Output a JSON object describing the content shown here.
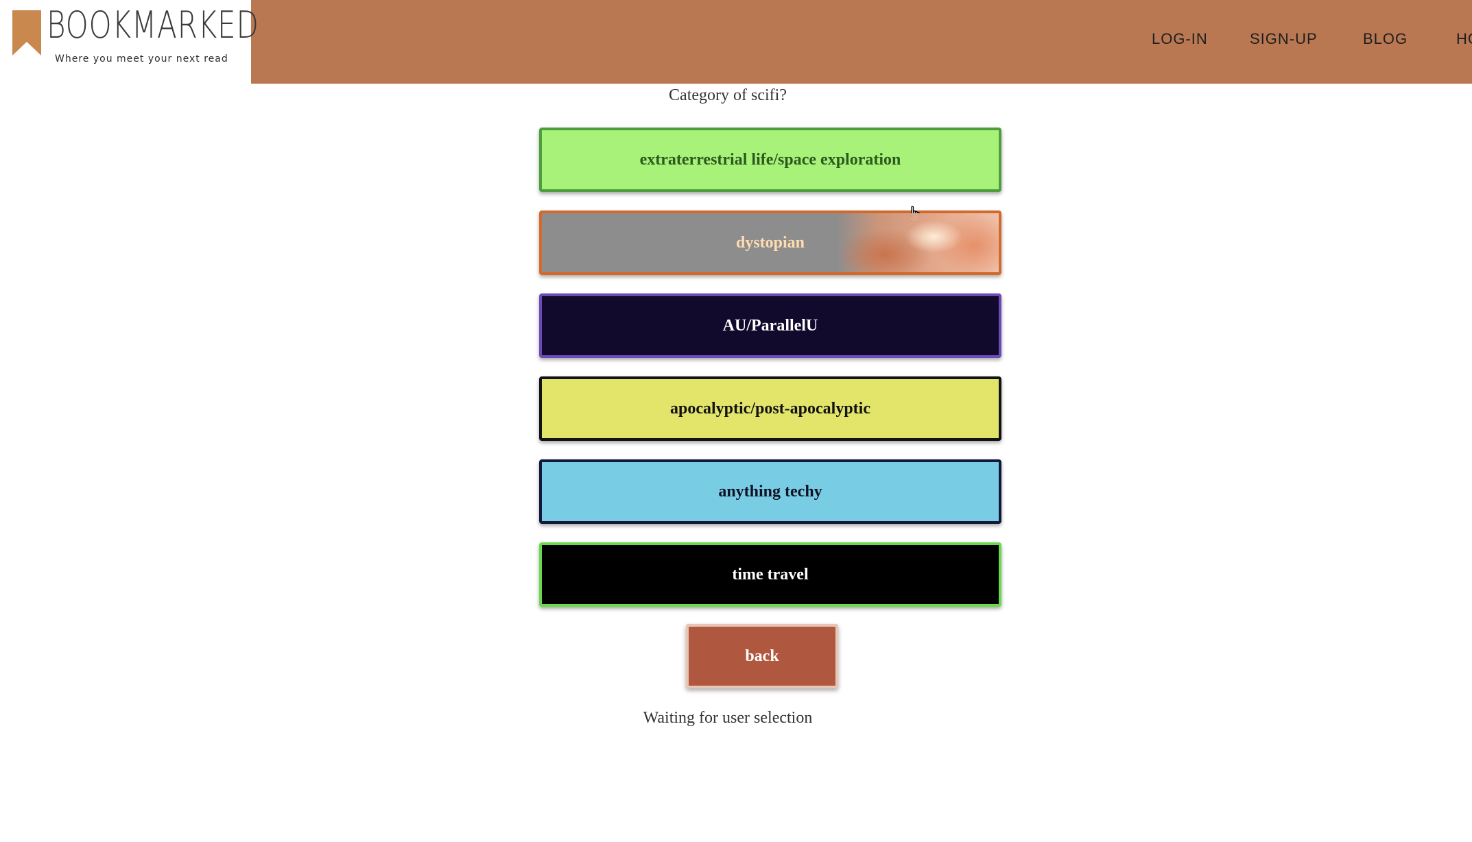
{
  "header": {
    "logo_title": "BOOKMARKED",
    "logo_tagline": "Where you meet your next read",
    "brand_color": "#b97852",
    "nav": [
      {
        "label": "LOG-IN"
      },
      {
        "label": "SIGN-UP"
      },
      {
        "label": "BLOG"
      },
      {
        "label": "HO"
      }
    ]
  },
  "main": {
    "question": "Category of scifi?",
    "options": [
      {
        "label": "extraterrestrial life/space exploration",
        "bg": "#a8f27a",
        "border": "#4e9e3d"
      },
      {
        "label": "dystopian",
        "bg": "#8d8d8d",
        "border": "#d26a2c"
      },
      {
        "label": "AU/ParallelU",
        "bg": "#120a2c",
        "border": "#6a4bb8"
      },
      {
        "label": "apocalyptic/post-apocalyptic",
        "bg": "#e3e46a",
        "border": "#121212"
      },
      {
        "label": "anything techy",
        "bg": "#78cde4",
        "border": "#13183a"
      },
      {
        "label": "time travel",
        "bg": "#000000",
        "border": "#6ad94e"
      }
    ],
    "back_label": "back",
    "status": "Waiting for user selection"
  },
  "icons": {
    "logo": "bookmark-ribbon-icon",
    "cursor": "hand-pointer-icon"
  }
}
